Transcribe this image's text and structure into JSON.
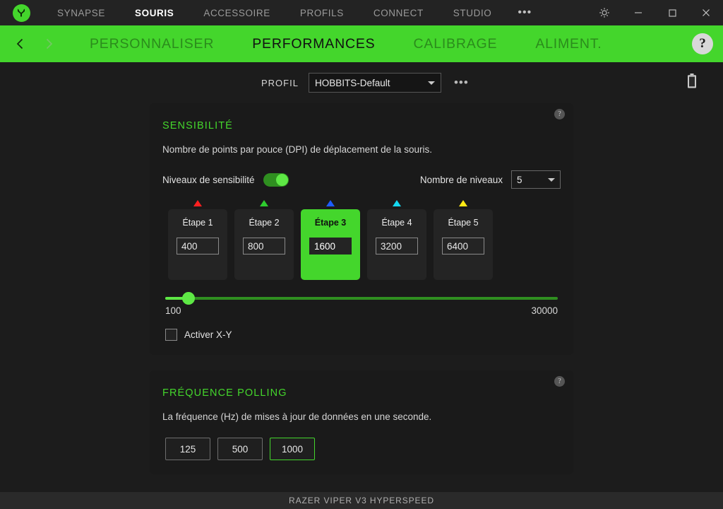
{
  "titlebar": {
    "logo_icon": "razer-logo-icon",
    "nav": [
      {
        "label": "SYNAPSE",
        "active": false
      },
      {
        "label": "SOURIS",
        "active": true
      },
      {
        "label": "ACCESSOIRE",
        "active": false
      },
      {
        "label": "PROFILS",
        "active": false
      },
      {
        "label": "CONNECT",
        "active": false
      },
      {
        "label": "STUDIO",
        "active": false
      }
    ],
    "more_label": "•••",
    "settings_icon": "gear-icon",
    "minimize_icon": "minimize-icon",
    "maximize_icon": "maximize-icon",
    "close_icon": "close-icon"
  },
  "tabbar": {
    "back_icon": "chevron-left-icon",
    "forward_icon": "chevron-right-icon",
    "tabs": [
      {
        "label": "PERSONNALISER",
        "active": false
      },
      {
        "label": "PERFORMANCES",
        "active": true
      },
      {
        "label": "CALIBRAGE",
        "active": false
      },
      {
        "label": "ALIMENT.",
        "active": false
      }
    ],
    "help_label": "?",
    "accent_color": "#44D62C"
  },
  "profile": {
    "label": "PROFIL",
    "value": "HOBBITS-Default",
    "more_label": "•••",
    "battery_icon": "battery-icon"
  },
  "sensitivity": {
    "help_label": "?",
    "title": "SENSIBILITÉ",
    "description": "Nombre de points par pouce (DPI) de déplacement de la souris.",
    "toggle_label": "Niveaux de sensibilité",
    "toggle_on": true,
    "levels_label": "Nombre de niveaux",
    "levels_value": "5",
    "stages": [
      {
        "name": "Étape 1",
        "value": "400",
        "marker_color": "#ff2020",
        "selected": false
      },
      {
        "name": "Étape 2",
        "value": "800",
        "marker_color": "#2ecc2e",
        "selected": false
      },
      {
        "name": "Étape 3",
        "value": "1600",
        "marker_color": "#1d5cff",
        "selected": true
      },
      {
        "name": "Étape 4",
        "value": "3200",
        "marker_color": "#14d8f0",
        "selected": false
      },
      {
        "name": "Étape 5",
        "value": "6400",
        "marker_color": "#ffe814",
        "selected": false
      }
    ],
    "slider": {
      "min_label": "100",
      "max_label": "30000",
      "value": "1600",
      "percent": 6.5
    },
    "xy_label": "Activer X-Y",
    "xy_checked": false
  },
  "polling": {
    "help_label": "?",
    "title": "FRÉQUENCE POLLING",
    "description": "La fréquence (Hz) de mises à jour de données en une seconde.",
    "options": [
      {
        "label": "125",
        "selected": false
      },
      {
        "label": "500",
        "selected": false
      },
      {
        "label": "1000",
        "selected": true
      }
    ]
  },
  "statusbar": {
    "device": "RAZER VIPER V3 HYPERSPEED"
  }
}
